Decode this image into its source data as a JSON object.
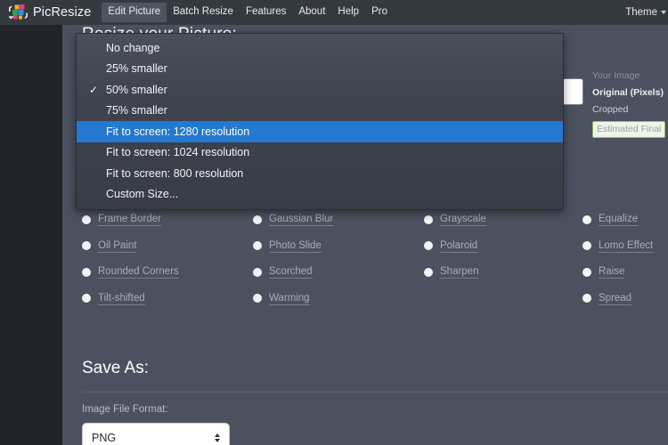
{
  "navbar": {
    "brand": "PicResize",
    "logo_icon": "picresize-logo-icon",
    "items": [
      {
        "label": "Edit Picture",
        "active": true
      },
      {
        "label": "Batch Resize",
        "active": false
      },
      {
        "label": "Features",
        "active": false
      },
      {
        "label": "About",
        "active": false
      },
      {
        "label": "Help",
        "active": false
      },
      {
        "label": "Pro",
        "active": false
      }
    ],
    "theme_label": "Theme",
    "theme_caret_icon": "chevron-down-icon"
  },
  "main": {
    "resize_heading": "Resize your Picture:",
    "save_heading": "Save As:",
    "file_format_label": "Image File Format:",
    "file_format_value": "PNG",
    "file_format_arrows_icon": "sort-updown-icon"
  },
  "info_panel": {
    "title": "Your Image",
    "rows": [
      "Original (Pixels)",
      "Cropped",
      "Estimated Final"
    ]
  },
  "dropdown": {
    "options": [
      {
        "label": "No change",
        "checked": false,
        "selected": false
      },
      {
        "label": "25% smaller",
        "checked": false,
        "selected": false
      },
      {
        "label": "50% smaller",
        "checked": true,
        "selected": false
      },
      {
        "label": "75% smaller",
        "checked": false,
        "selected": false
      },
      {
        "label": "Fit to screen: 1280 resolution",
        "checked": false,
        "selected": true
      },
      {
        "label": "Fit to screen: 1024 resolution",
        "checked": false,
        "selected": false
      },
      {
        "label": "Fit to screen: 800 resolution",
        "checked": false,
        "selected": false
      },
      {
        "label": "Custom Size...",
        "checked": false,
        "selected": false
      }
    ],
    "check_glyph": "✓"
  },
  "effects": {
    "items": [
      "Frame Border",
      "Gaussian Blur",
      "Grayscale",
      "Equalize",
      "Oil Paint",
      "Photo Slide",
      "Polaroid",
      "Lomo Effect",
      "Rounded Corners",
      "Scorched",
      "Sharpen",
      "Raise",
      "Tilt-shifted",
      "Warming",
      "",
      "Spread"
    ]
  },
  "colors": {
    "page_bg": "#4b515e",
    "navbar_bg": "#343a40",
    "gutter_bg": "#212429",
    "highlight_blue": "#2478cf",
    "estimate_green": "#8fbf6a"
  }
}
